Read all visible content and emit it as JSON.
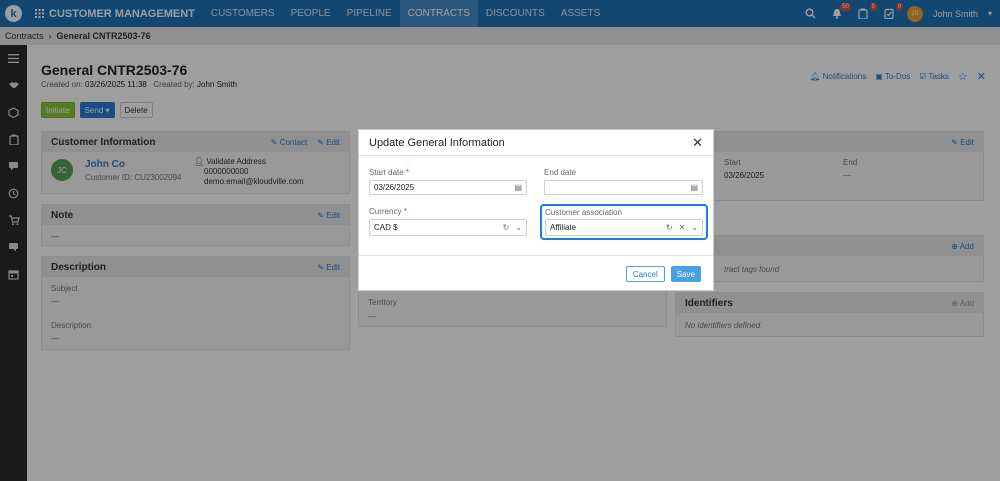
{
  "nav": {
    "logo_letter": "k",
    "app_title": "CUSTOMER MANAGEMENT",
    "items": [
      {
        "label": "CUSTOMERS"
      },
      {
        "label": "PEOPLE"
      },
      {
        "label": "PIPELINE"
      },
      {
        "label": "CONTRACTS"
      },
      {
        "label": "DISCOUNTS"
      },
      {
        "label": "ASSETS"
      }
    ],
    "active": "CONTRACTS",
    "notif_count": "50",
    "todo_count": "5",
    "task_count": "9",
    "user_initials": "JS",
    "user_name": "John Smith"
  },
  "breadcrumb": {
    "parent": "Contracts",
    "current": "General CNTR2503-76"
  },
  "page": {
    "title": "General CNTR2503-76",
    "created_on_label": "Created on:",
    "created_on": "03/26/2025 11:38",
    "created_by_label": "Created by:",
    "created_by": "John Smith",
    "buttons": {
      "initiate": "Initiate",
      "send": "Send",
      "delete": "Delete"
    },
    "top_links": {
      "notifications": "Notifications",
      "todos": "To-Dos",
      "tasks": "Tasks"
    }
  },
  "customer_info": {
    "title": "Customer Information",
    "contact": "Contact",
    "edit": "Edit",
    "initials": "JC",
    "name": "John Co",
    "customer_id": "Customer ID: CU23002094",
    "validate": "Validate Address",
    "phone": "0000000000",
    "email": "demo.email@kloudville.com"
  },
  "note": {
    "title": "Note",
    "edit": "Edit",
    "value": "—"
  },
  "description": {
    "title": "Description",
    "edit": "Edit",
    "subject_label": "Subject",
    "subject_value": "—",
    "desc_label": "Description",
    "desc_value": "—"
  },
  "right_panel": {
    "edit": "Edit",
    "start_label": "Start",
    "start_value": "03/26/2025",
    "end_label": "End",
    "end_value": "—",
    "add": "Add",
    "tags_text": "tract tags found",
    "identifiers_title": "Identifiers",
    "identifiers_add": "Add",
    "identifiers_text": "No identifiers defined"
  },
  "territory": {
    "label": "Territory",
    "value": "—"
  },
  "modal": {
    "title": "Update General Information",
    "start_date_label": "Start date",
    "start_date_value": "03/26/2025",
    "end_date_label": "End date",
    "end_date_value": "",
    "currency_label": "Currency",
    "currency_value": "CAD $",
    "assoc_label": "Customer association",
    "assoc_value": "Affiliate",
    "cancel": "Cancel",
    "save": "Save"
  }
}
